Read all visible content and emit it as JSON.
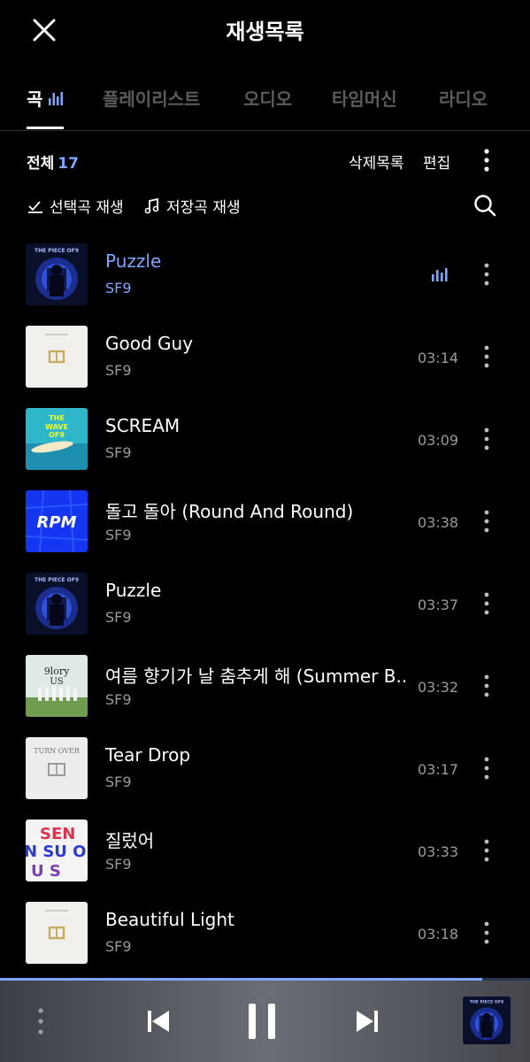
{
  "header": {
    "title": "재생목록",
    "close_icon": "close-icon"
  },
  "tabs": [
    {
      "label": "곡",
      "active": true,
      "icon": "equalizer-icon"
    },
    {
      "label": "플레이리스트",
      "active": false
    },
    {
      "label": "오디오",
      "active": false
    },
    {
      "label": "타임머신",
      "active": false
    },
    {
      "label": "라디오",
      "active": false
    }
  ],
  "toolbar": {
    "count_label": "전체",
    "count_value": "17",
    "deleted_list_label": "삭제목록",
    "edit_label": "편집",
    "play_selected_label": "선택곡 재생",
    "play_saved_label": "저장곡 재생"
  },
  "tracks": [
    {
      "title": "Puzzle",
      "artist": "SF9",
      "duration": "",
      "playing": true,
      "art": "puzzle"
    },
    {
      "title": "Good Guy",
      "artist": "SF9",
      "duration": "03:14",
      "playing": false,
      "art": "white"
    },
    {
      "title": "SCREAM",
      "artist": "SF9",
      "duration": "03:09",
      "playing": false,
      "art": "wave"
    },
    {
      "title": "돌고 돌아 (Round And Round)",
      "artist": "SF9",
      "duration": "03:38",
      "playing": false,
      "art": "rpm"
    },
    {
      "title": "Puzzle",
      "artist": "SF9",
      "duration": "03:37",
      "playing": false,
      "art": "puzzle"
    },
    {
      "title": "여름 향기가 날 춤추게 해 (Summer B..",
      "artist": "SF9",
      "duration": "03:32",
      "playing": false,
      "art": "glory"
    },
    {
      "title": "Tear Drop",
      "artist": "SF9",
      "duration": "03:17",
      "playing": false,
      "art": "turnover"
    },
    {
      "title": "질렀어",
      "artist": "SF9",
      "duration": "03:33",
      "playing": false,
      "art": "sensuous"
    },
    {
      "title": "Beautiful Light",
      "artist": "SF9",
      "duration": "03:18",
      "playing": false,
      "art": "white"
    }
  ],
  "art_text": {
    "puzzle": "THE PIECE OF9",
    "wave": "THE WAVE OF9",
    "rpm": "RPM",
    "glory": "9lory US",
    "turnover": "TURN OVER",
    "sensuous": "SEN SU OU S"
  },
  "player": {
    "progress": 0.91,
    "state": "playing"
  },
  "colors": {
    "accent": "#7ea6ff",
    "background": "#000000",
    "muted": "#9a9a9a"
  }
}
